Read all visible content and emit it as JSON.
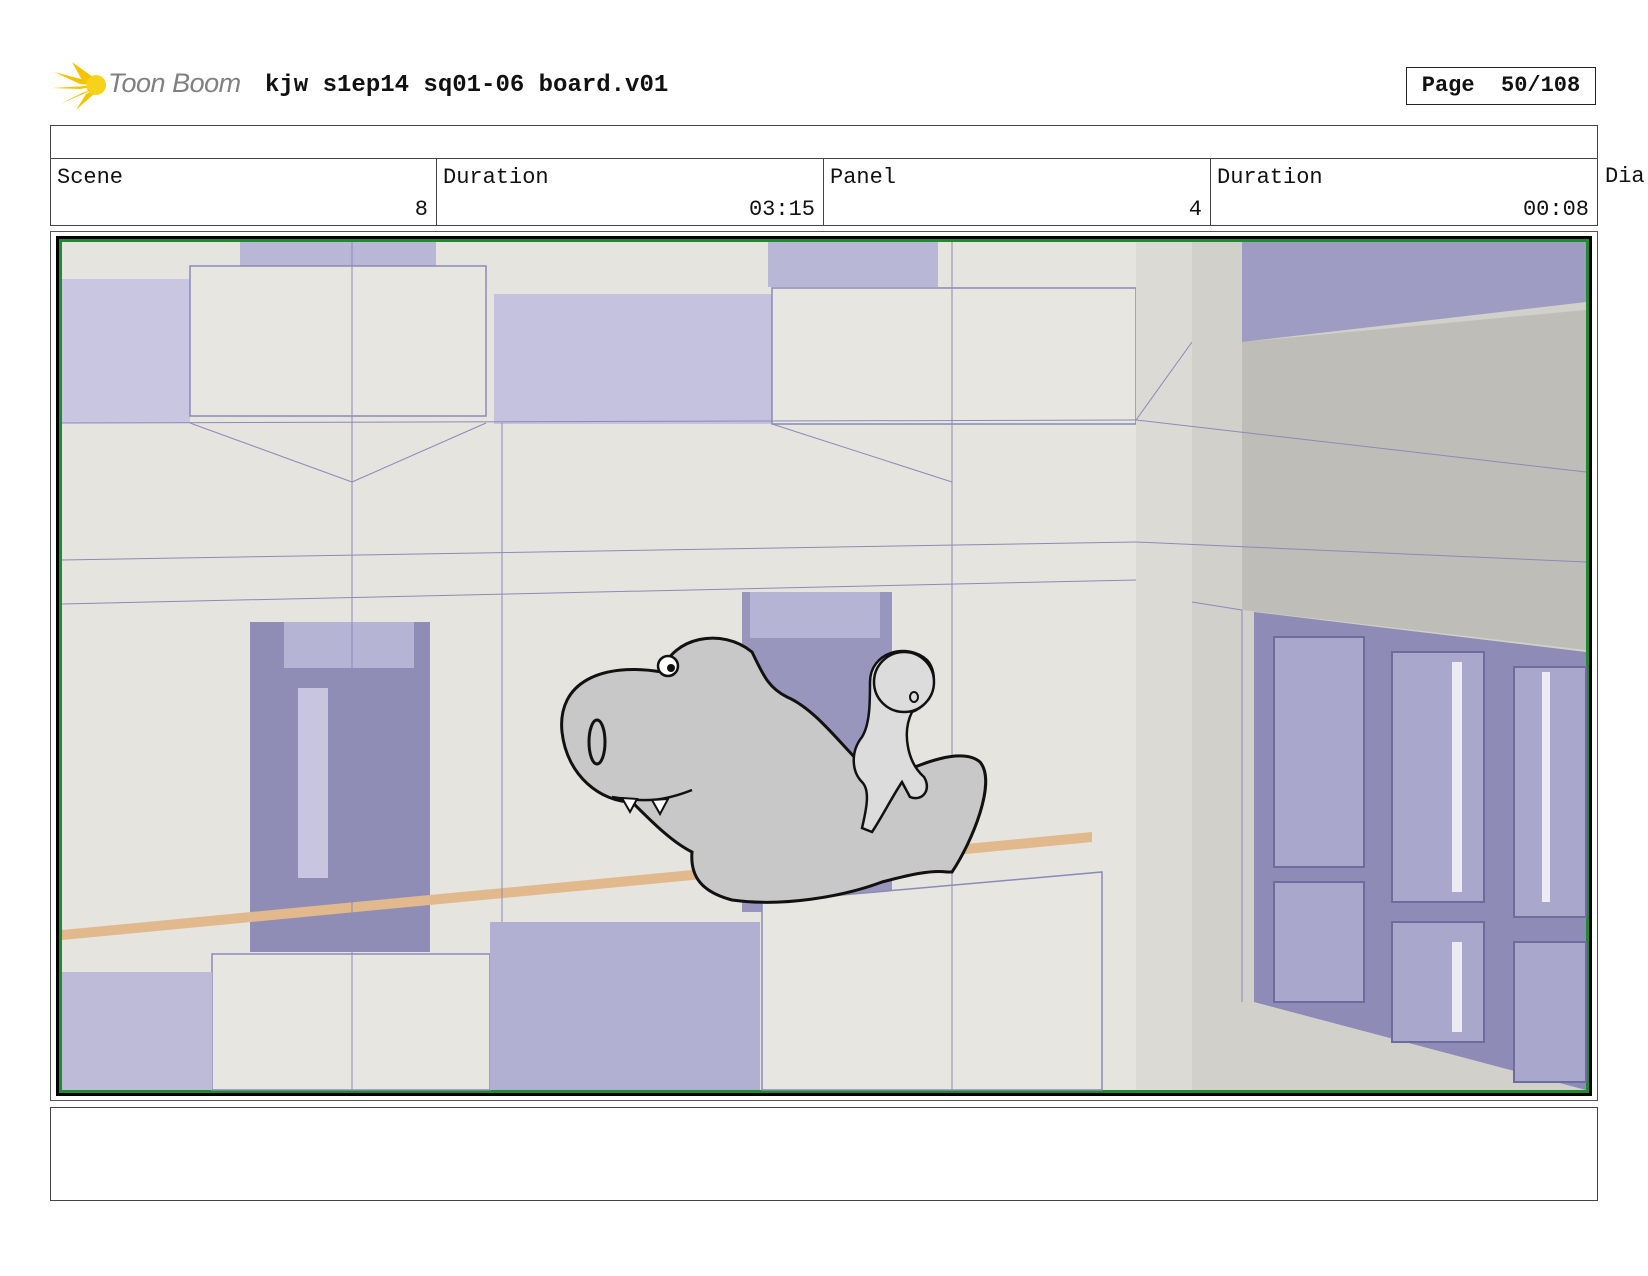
{
  "header": {
    "brand": "Toon Boom",
    "project_title": "kjw s1ep14 sq01-06 board.v01",
    "page_label": "Page",
    "page_value": "50/108"
  },
  "info": {
    "scene_label": "Scene",
    "scene_value": "8",
    "scene_duration_label": "Duration",
    "scene_duration_value": "03:15",
    "panel_label": "Panel",
    "panel_value": "4",
    "panel_duration_label": "Duration",
    "panel_duration_value": "00:08",
    "dialogue_label_clipped": "Dia"
  },
  "colors": {
    "wall": "#e6e4de",
    "glass": "#b9b7d6",
    "frame_border": "#1e8c2e",
    "character_fill": "#c8c8c8"
  },
  "icons": [
    "toon-boom-logo-icon"
  ]
}
